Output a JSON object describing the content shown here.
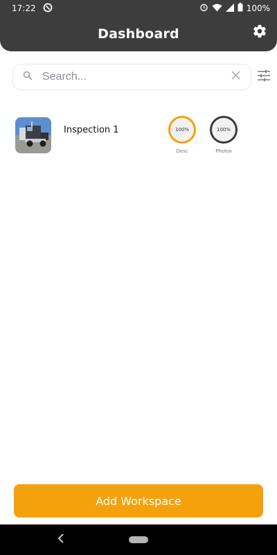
{
  "status_bar": {
    "time": "17:22",
    "battery": "100%"
  },
  "header": {
    "title": "Dashboard",
    "settings_icon": "gear-icon"
  },
  "search": {
    "placeholder": "Search...",
    "value": "",
    "search_icon": "search-icon",
    "clear_icon": "close-icon",
    "filter_icon": "sliders-icon"
  },
  "workspaces": [
    {
      "title": "Inspection 1",
      "stats": [
        {
          "value": "100%",
          "label": "Desc",
          "color": "#f4a20c"
        },
        {
          "value": "100%",
          "label": "Photos",
          "color": "#3a3a3a"
        }
      ]
    }
  ],
  "actions": {
    "add_workspace_label": "Add Workspace",
    "accent_color": "#f4a20c"
  },
  "nav": {
    "back_icon": "back-icon",
    "home_icon": "home-pill-icon"
  }
}
